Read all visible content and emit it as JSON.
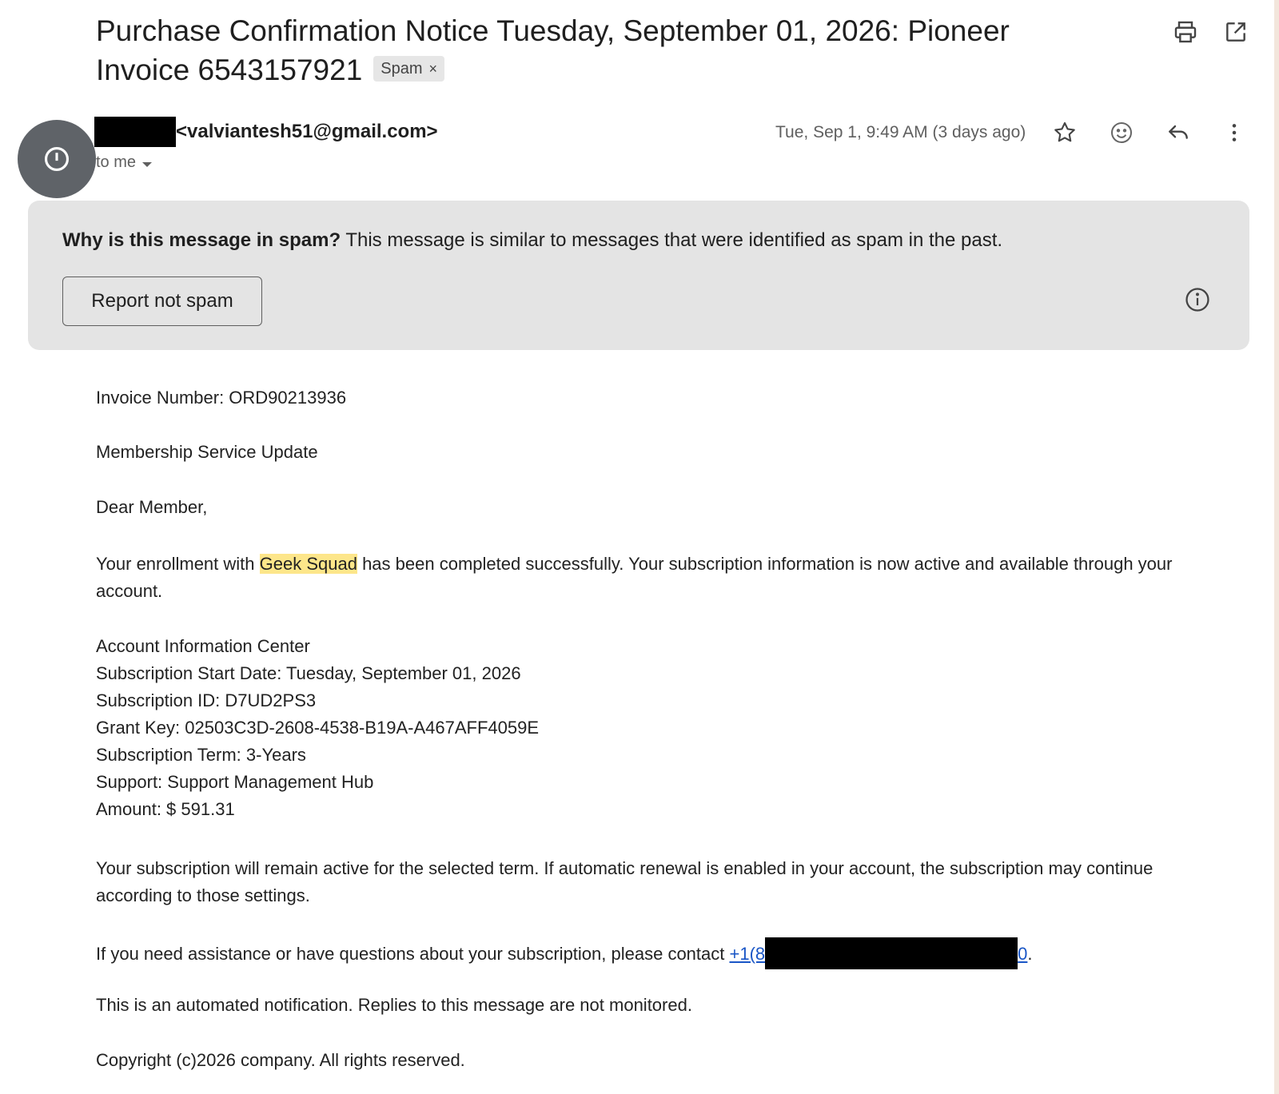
{
  "subject": {
    "text": "Purchase Confirmation Notice Tuesday, September 01, 2026: Pioneer Invoice 6543157921",
    "spam_label": "Spam",
    "spam_remove": "×"
  },
  "toolbar": {
    "print_icon": "print-icon",
    "open_new_window_icon": "open-in-new-window-icon"
  },
  "sender": {
    "email": "<valviantesh51@gmail.com>",
    "to": "to me",
    "date": "Tue, Sep 1, 9:49 AM (3 days ago)",
    "icons": [
      "star-icon",
      "emoji-icon",
      "reply-icon",
      "more-vert-icon"
    ]
  },
  "spam_banner": {
    "title": "Why is this message in spam?",
    "text": "This message is similar to messages that were identified as spam in the past.",
    "button": "Report not spam"
  },
  "body": {
    "invoice": "Invoice Number: ORD90213936",
    "update": "Membership Service Update",
    "greeting": "Dear Member,",
    "enroll_pre": "Your enrollment with ",
    "enroll_highlight": "Geek Squad",
    "enroll_post": " has been completed successfully. Your subscription information is now active and available through your account.",
    "details": [
      "Account Information Center",
      "Subscription Start Date: Tuesday, September 01, 2026",
      "Subscription ID: D7UD2PS3",
      "Grant Key: 02503C3D-2608-4538-B19A-A467AFF4059E",
      "Subscription Term: 3-Years",
      "Support: Support Management Hub",
      "Amount: $ 591.31"
    ],
    "renewal": "Your subscription will remain active for the selected term. If automatic renewal is enabled in your account, the subscription may continue according to those settings.",
    "contact_pre": "If you need assistance or have questions about your subscription, please contact ",
    "contact_link_start": "+1(8",
    "contact_link_end": "0",
    "contact_post": ".",
    "automated": "This is an automated notification. Replies to this message are not monitored.",
    "copyright": "Copyright (c)2026 company. All rights reserved."
  }
}
